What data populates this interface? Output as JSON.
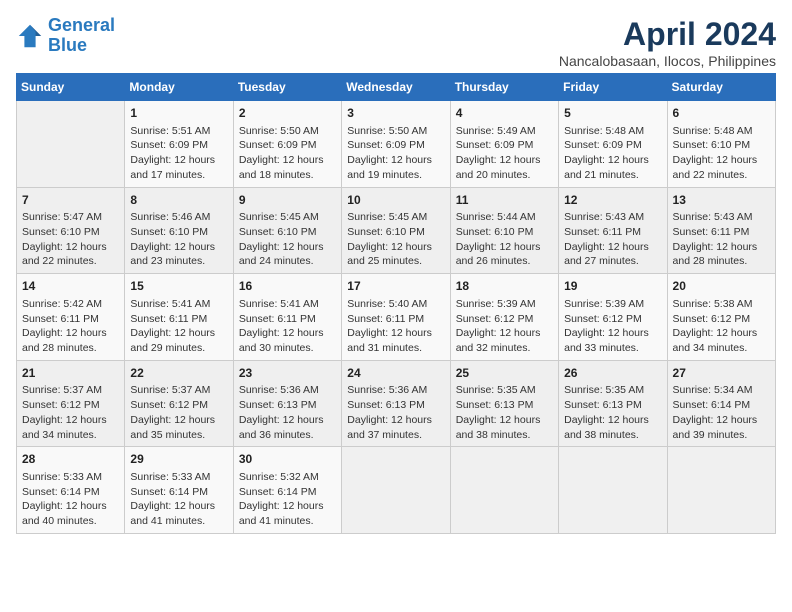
{
  "logo": {
    "line1": "General",
    "line2": "Blue"
  },
  "title": "April 2024",
  "location": "Nancalobasaan, Ilocos, Philippines",
  "days_of_week": [
    "Sunday",
    "Monday",
    "Tuesday",
    "Wednesday",
    "Thursday",
    "Friday",
    "Saturday"
  ],
  "weeks": [
    [
      {
        "day": "",
        "sunrise": "",
        "sunset": "",
        "daylight": ""
      },
      {
        "day": "1",
        "sunrise": "Sunrise: 5:51 AM",
        "sunset": "Sunset: 6:09 PM",
        "daylight": "Daylight: 12 hours and 17 minutes."
      },
      {
        "day": "2",
        "sunrise": "Sunrise: 5:50 AM",
        "sunset": "Sunset: 6:09 PM",
        "daylight": "Daylight: 12 hours and 18 minutes."
      },
      {
        "day": "3",
        "sunrise": "Sunrise: 5:50 AM",
        "sunset": "Sunset: 6:09 PM",
        "daylight": "Daylight: 12 hours and 19 minutes."
      },
      {
        "day": "4",
        "sunrise": "Sunrise: 5:49 AM",
        "sunset": "Sunset: 6:09 PM",
        "daylight": "Daylight: 12 hours and 20 minutes."
      },
      {
        "day": "5",
        "sunrise": "Sunrise: 5:48 AM",
        "sunset": "Sunset: 6:09 PM",
        "daylight": "Daylight: 12 hours and 21 minutes."
      },
      {
        "day": "6",
        "sunrise": "Sunrise: 5:48 AM",
        "sunset": "Sunset: 6:10 PM",
        "daylight": "Daylight: 12 hours and 22 minutes."
      }
    ],
    [
      {
        "day": "7",
        "sunrise": "Sunrise: 5:47 AM",
        "sunset": "Sunset: 6:10 PM",
        "daylight": "Daylight: 12 hours and 22 minutes."
      },
      {
        "day": "8",
        "sunrise": "Sunrise: 5:46 AM",
        "sunset": "Sunset: 6:10 PM",
        "daylight": "Daylight: 12 hours and 23 minutes."
      },
      {
        "day": "9",
        "sunrise": "Sunrise: 5:45 AM",
        "sunset": "Sunset: 6:10 PM",
        "daylight": "Daylight: 12 hours and 24 minutes."
      },
      {
        "day": "10",
        "sunrise": "Sunrise: 5:45 AM",
        "sunset": "Sunset: 6:10 PM",
        "daylight": "Daylight: 12 hours and 25 minutes."
      },
      {
        "day": "11",
        "sunrise": "Sunrise: 5:44 AM",
        "sunset": "Sunset: 6:10 PM",
        "daylight": "Daylight: 12 hours and 26 minutes."
      },
      {
        "day": "12",
        "sunrise": "Sunrise: 5:43 AM",
        "sunset": "Sunset: 6:11 PM",
        "daylight": "Daylight: 12 hours and 27 minutes."
      },
      {
        "day": "13",
        "sunrise": "Sunrise: 5:43 AM",
        "sunset": "Sunset: 6:11 PM",
        "daylight": "Daylight: 12 hours and 28 minutes."
      }
    ],
    [
      {
        "day": "14",
        "sunrise": "Sunrise: 5:42 AM",
        "sunset": "Sunset: 6:11 PM",
        "daylight": "Daylight: 12 hours and 28 minutes."
      },
      {
        "day": "15",
        "sunrise": "Sunrise: 5:41 AM",
        "sunset": "Sunset: 6:11 PM",
        "daylight": "Daylight: 12 hours and 29 minutes."
      },
      {
        "day": "16",
        "sunrise": "Sunrise: 5:41 AM",
        "sunset": "Sunset: 6:11 PM",
        "daylight": "Daylight: 12 hours and 30 minutes."
      },
      {
        "day": "17",
        "sunrise": "Sunrise: 5:40 AM",
        "sunset": "Sunset: 6:11 PM",
        "daylight": "Daylight: 12 hours and 31 minutes."
      },
      {
        "day": "18",
        "sunrise": "Sunrise: 5:39 AM",
        "sunset": "Sunset: 6:12 PM",
        "daylight": "Daylight: 12 hours and 32 minutes."
      },
      {
        "day": "19",
        "sunrise": "Sunrise: 5:39 AM",
        "sunset": "Sunset: 6:12 PM",
        "daylight": "Daylight: 12 hours and 33 minutes."
      },
      {
        "day": "20",
        "sunrise": "Sunrise: 5:38 AM",
        "sunset": "Sunset: 6:12 PM",
        "daylight": "Daylight: 12 hours and 34 minutes."
      }
    ],
    [
      {
        "day": "21",
        "sunrise": "Sunrise: 5:37 AM",
        "sunset": "Sunset: 6:12 PM",
        "daylight": "Daylight: 12 hours and 34 minutes."
      },
      {
        "day": "22",
        "sunrise": "Sunrise: 5:37 AM",
        "sunset": "Sunset: 6:12 PM",
        "daylight": "Daylight: 12 hours and 35 minutes."
      },
      {
        "day": "23",
        "sunrise": "Sunrise: 5:36 AM",
        "sunset": "Sunset: 6:13 PM",
        "daylight": "Daylight: 12 hours and 36 minutes."
      },
      {
        "day": "24",
        "sunrise": "Sunrise: 5:36 AM",
        "sunset": "Sunset: 6:13 PM",
        "daylight": "Daylight: 12 hours and 37 minutes."
      },
      {
        "day": "25",
        "sunrise": "Sunrise: 5:35 AM",
        "sunset": "Sunset: 6:13 PM",
        "daylight": "Daylight: 12 hours and 38 minutes."
      },
      {
        "day": "26",
        "sunrise": "Sunrise: 5:35 AM",
        "sunset": "Sunset: 6:13 PM",
        "daylight": "Daylight: 12 hours and 38 minutes."
      },
      {
        "day": "27",
        "sunrise": "Sunrise: 5:34 AM",
        "sunset": "Sunset: 6:14 PM",
        "daylight": "Daylight: 12 hours and 39 minutes."
      }
    ],
    [
      {
        "day": "28",
        "sunrise": "Sunrise: 5:33 AM",
        "sunset": "Sunset: 6:14 PM",
        "daylight": "Daylight: 12 hours and 40 minutes."
      },
      {
        "day": "29",
        "sunrise": "Sunrise: 5:33 AM",
        "sunset": "Sunset: 6:14 PM",
        "daylight": "Daylight: 12 hours and 41 minutes."
      },
      {
        "day": "30",
        "sunrise": "Sunrise: 5:32 AM",
        "sunset": "Sunset: 6:14 PM",
        "daylight": "Daylight: 12 hours and 41 minutes."
      },
      {
        "day": "",
        "sunrise": "",
        "sunset": "",
        "daylight": ""
      },
      {
        "day": "",
        "sunrise": "",
        "sunset": "",
        "daylight": ""
      },
      {
        "day": "",
        "sunrise": "",
        "sunset": "",
        "daylight": ""
      },
      {
        "day": "",
        "sunrise": "",
        "sunset": "",
        "daylight": ""
      }
    ]
  ]
}
